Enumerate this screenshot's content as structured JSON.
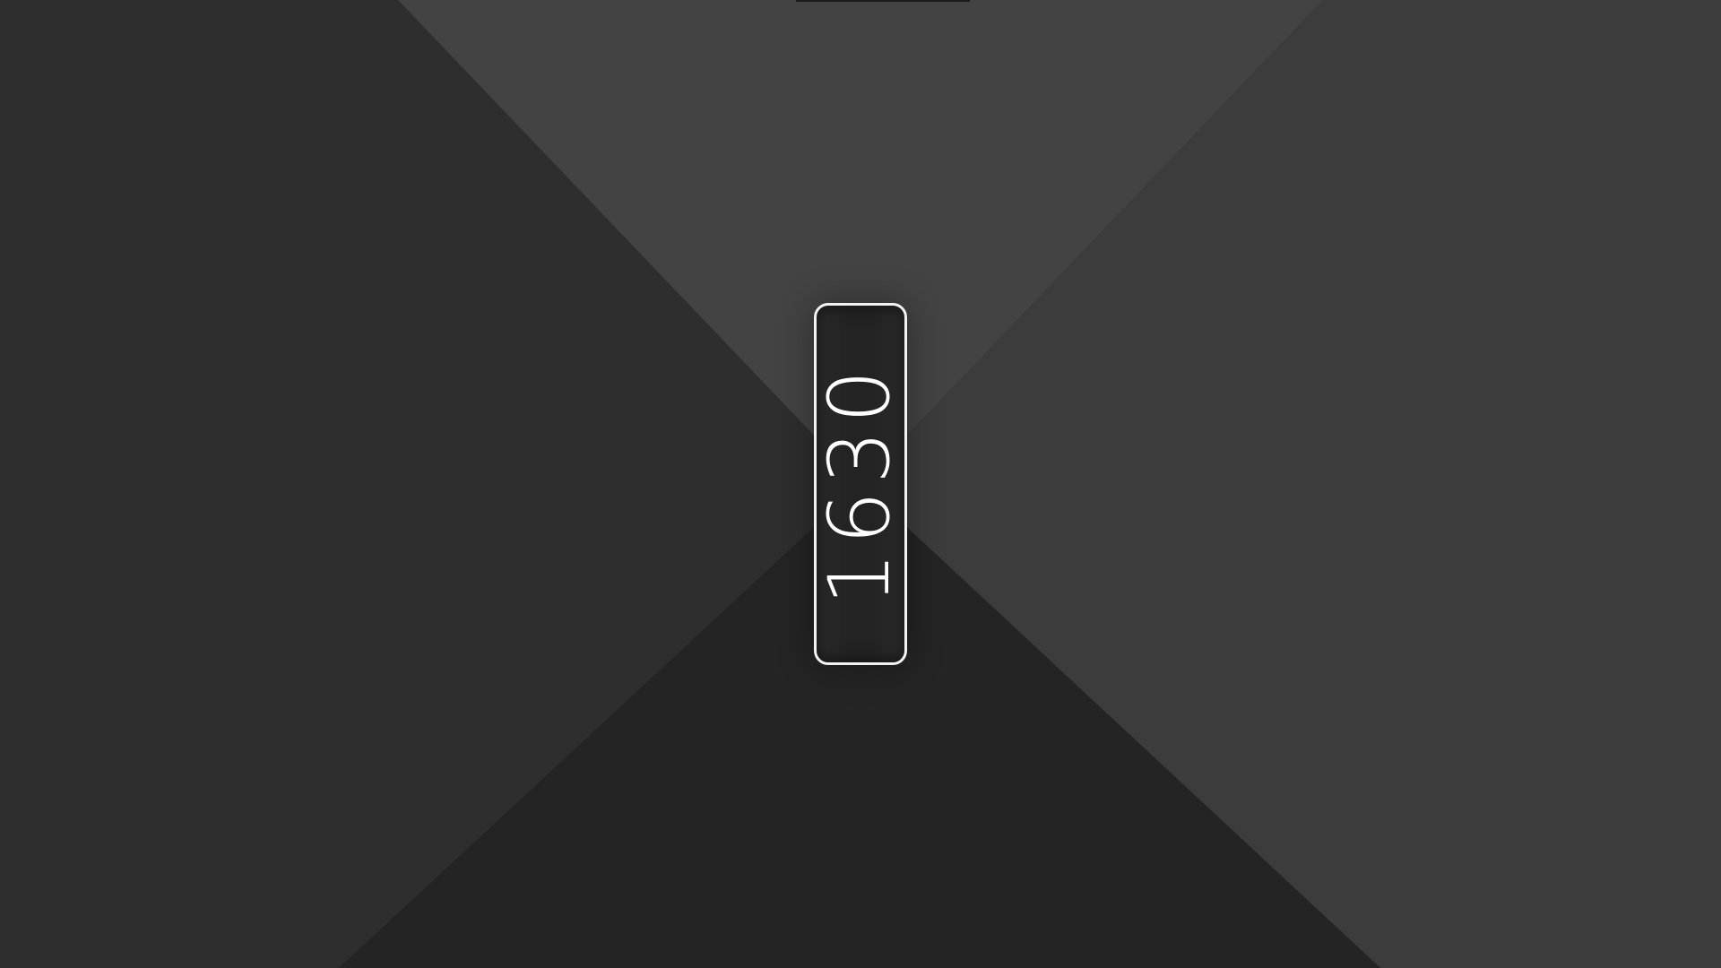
{
  "counter": {
    "value": "1630"
  },
  "colors": {
    "left_panel": "#2e2e2e",
    "top_panel": "#434343",
    "right_panel": "#3c3c3c",
    "bottom_panel": "#242424",
    "counter_border": "#f2f2f2",
    "counter_text": "#ffffff"
  }
}
